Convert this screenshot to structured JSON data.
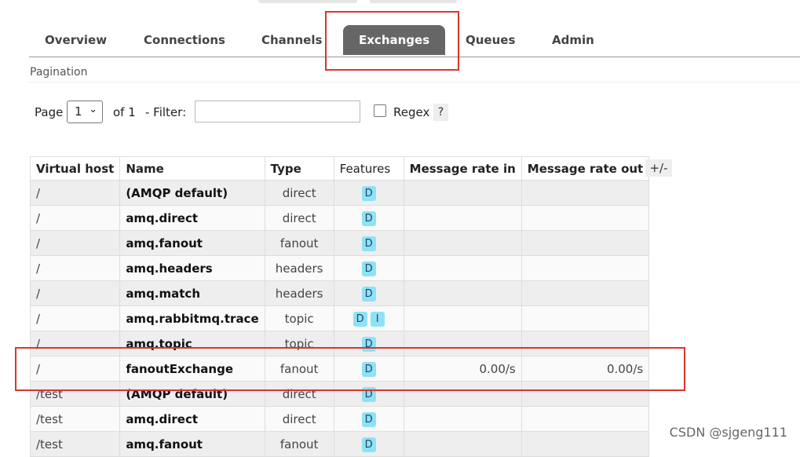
{
  "tabs": {
    "overview": "Overview",
    "connections": "Connections",
    "channels": "Channels",
    "exchanges": "Exchanges",
    "queues": "Queues",
    "admin": "Admin"
  },
  "pagination": {
    "title": "Pagination",
    "page_label": "Page",
    "page_value": "1",
    "of_label": "of 1",
    "filter_label": "- Filter:",
    "filter_value": "",
    "regex_label": "Regex",
    "help_label": "?"
  },
  "table": {
    "headers": {
      "virtual_host": "Virtual host",
      "name": "Name",
      "type": "Type",
      "features": "Features",
      "rate_in": "Message rate in",
      "rate_out": "Message rate out"
    },
    "column_toggle": "+/-",
    "rows": [
      {
        "vhost": "/",
        "name": "(AMQP default)",
        "type": "direct",
        "f1": "D",
        "f2": "",
        "rate_in": "",
        "rate_out": ""
      },
      {
        "vhost": "/",
        "name": "amq.direct",
        "type": "direct",
        "f1": "D",
        "f2": "",
        "rate_in": "",
        "rate_out": ""
      },
      {
        "vhost": "/",
        "name": "amq.fanout",
        "type": "fanout",
        "f1": "D",
        "f2": "",
        "rate_in": "",
        "rate_out": ""
      },
      {
        "vhost": "/",
        "name": "amq.headers",
        "type": "headers",
        "f1": "D",
        "f2": "",
        "rate_in": "",
        "rate_out": ""
      },
      {
        "vhost": "/",
        "name": "amq.match",
        "type": "headers",
        "f1": "D",
        "f2": "",
        "rate_in": "",
        "rate_out": ""
      },
      {
        "vhost": "/",
        "name": "amq.rabbitmq.trace",
        "type": "topic",
        "f1": "D",
        "f2": "I",
        "rate_in": "",
        "rate_out": ""
      },
      {
        "vhost": "/",
        "name": "amq.topic",
        "type": "topic",
        "f1": "D",
        "f2": "",
        "rate_in": "",
        "rate_out": ""
      },
      {
        "vhost": "/",
        "name": "fanoutExchange",
        "type": "fanout",
        "f1": "D",
        "f2": "",
        "rate_in": "0.00/s",
        "rate_out": "0.00/s"
      },
      {
        "vhost": "/test",
        "name": "(AMQP default)",
        "type": "direct",
        "f1": "D",
        "f2": "",
        "rate_in": "",
        "rate_out": ""
      },
      {
        "vhost": "/test",
        "name": "amq.direct",
        "type": "direct",
        "f1": "D",
        "f2": "",
        "rate_in": "",
        "rate_out": ""
      },
      {
        "vhost": "/test",
        "name": "amq.fanout",
        "type": "fanout",
        "f1": "D",
        "f2": "",
        "rate_in": "",
        "rate_out": ""
      }
    ]
  },
  "watermark": "CSDN @sjgeng111",
  "colors": {
    "active_tab": "#666666",
    "badge": "#8ee2f7",
    "annotation": "#d9362b"
  }
}
